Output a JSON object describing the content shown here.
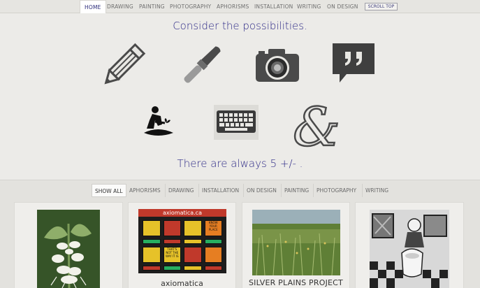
{
  "nav": {
    "items": [
      "HOME",
      "DRAWING",
      "PAINTING",
      "PHOTOGRAPHY",
      "APHORISMS",
      "INSTALLATION",
      "WRITING",
      "ON DESIGN"
    ],
    "scroll_label": "SCROLL TOP"
  },
  "hero": {
    "headline": "Consider the possibilities.",
    "footer": "There are always 5  +/-  ."
  },
  "filters": [
    "SHOW ALL",
    "APHORISMS",
    "DRAWING",
    "INSTALLATION",
    "ON DESIGN",
    "PAINTING",
    "PHOTOGRAPHY",
    "WRITING"
  ],
  "cards": [
    {
      "caption": ""
    },
    {
      "caption": "axiomatica",
      "board_title": "axiomatica.ca",
      "tiles": [
        "",
        "",
        "",
        "KNOW YOUR PLACE",
        "",
        "",
        "",
        "",
        "",
        "THAT'S NOT THE WAY IT IS",
        "",
        "",
        "",
        "",
        "",
        ""
      ]
    },
    {
      "caption": "SILVER PLAINS PROJECT"
    },
    {
      "caption": ""
    }
  ],
  "colors": {
    "accent": "#2e2a87",
    "icon": "#4a4a4a"
  },
  "icons": [
    "pencil-icon",
    "paintbrush-icon",
    "camera-icon",
    "quote-icon",
    "gardener-icon",
    "keyboard-icon",
    "ampersand-icon"
  ]
}
